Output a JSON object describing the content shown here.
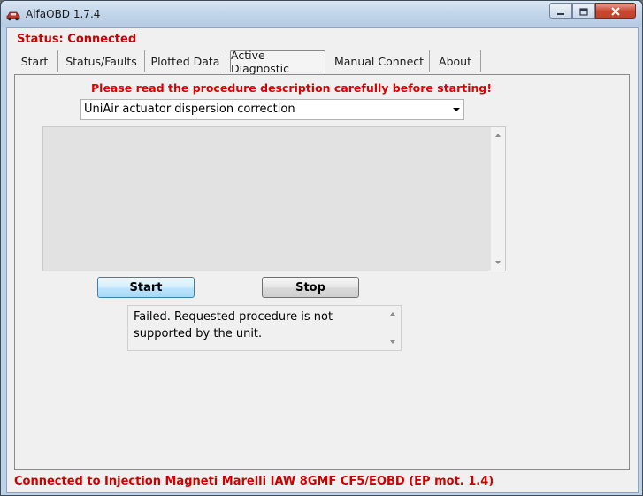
{
  "window": {
    "title": "AlfaOBD 1.7.4",
    "app_icon": "car-icon",
    "controls": {
      "minimize": "minimize-icon",
      "maximize": "maximize-icon",
      "close": "close-icon"
    }
  },
  "status": "Status: Connected",
  "tabs": [
    {
      "label": "Start"
    },
    {
      "label": "Status/Faults"
    },
    {
      "label": "Plotted Data"
    },
    {
      "label": "Active Diagnostic",
      "active": true
    },
    {
      "label": "Manual Connect"
    },
    {
      "label": "About"
    }
  ],
  "active_diagnostic": {
    "warning": "Please read the procedure description carefully before starting!",
    "procedure_select": {
      "selected": "UniAir actuator dispersion correction"
    },
    "description_text": "",
    "buttons": {
      "start": "Start",
      "stop": "Stop"
    },
    "result_text": "Failed. Requested procedure is not supported by the unit."
  },
  "footer": "Connected to Injection Magneti Marelli IAW 8GMF CF5/EOBD (EP mot. 1.4)",
  "colors": {
    "status_red": "#cc0000",
    "warning_red": "#dd0000",
    "titlebar": "#c3d6ea",
    "close_button": "#c8462e"
  }
}
